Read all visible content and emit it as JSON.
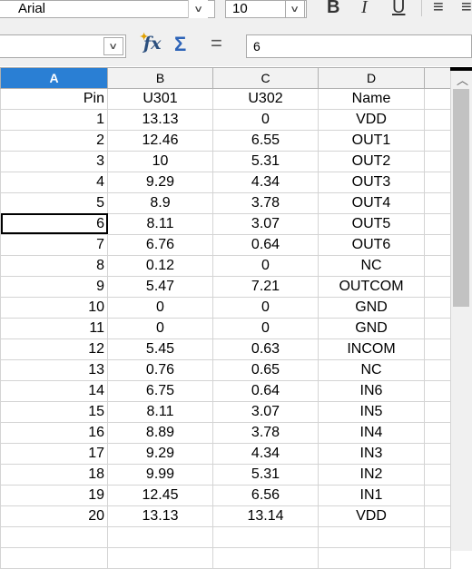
{
  "toolbar": {
    "font_name": "Arial",
    "font_size": "10",
    "bold_label": "B",
    "italic_label": "I",
    "underline_label": "U",
    "align_glyph": "≡"
  },
  "formula_bar": {
    "name_box": "",
    "formula_value": "6",
    "fx_glyph": "fx",
    "sum_glyph": "Σ",
    "equals_glyph": "="
  },
  "columns": [
    "A",
    "B",
    "C",
    "D"
  ],
  "header_row": {
    "a": "Pin",
    "b": "U301",
    "c": "U302",
    "d": "Name"
  },
  "rows": [
    {
      "a": "1",
      "b": "13.13",
      "c": "0",
      "d": "VDD"
    },
    {
      "a": "2",
      "b": "12.46",
      "c": "6.55",
      "d": "OUT1"
    },
    {
      "a": "3",
      "b": "10",
      "c": "5.31",
      "d": "OUT2"
    },
    {
      "a": "4",
      "b": "9.29",
      "c": "4.34",
      "d": "OUT3"
    },
    {
      "a": "5",
      "b": "8.9",
      "c": "3.78",
      "d": "OUT4"
    },
    {
      "a": "6",
      "b": "8.11",
      "c": "3.07",
      "d": "OUT5"
    },
    {
      "a": "7",
      "b": "6.76",
      "c": "0.64",
      "d": "OUT6"
    },
    {
      "a": "8",
      "b": "0.12",
      "c": "0",
      "d": "NC"
    },
    {
      "a": "9",
      "b": "5.47",
      "c": "7.21",
      "d": "OUTCOM"
    },
    {
      "a": "10",
      "b": "0",
      "c": "0",
      "d": "GND"
    },
    {
      "a": "11",
      "b": "0",
      "c": "0",
      "d": "GND"
    },
    {
      "a": "12",
      "b": "5.45",
      "c": "0.63",
      "d": "INCOM"
    },
    {
      "a": "13",
      "b": "0.76",
      "c": "0.65",
      "d": "NC"
    },
    {
      "a": "14",
      "b": "6.75",
      "c": "0.64",
      "d": "IN6"
    },
    {
      "a": "15",
      "b": "8.11",
      "c": "3.07",
      "d": "IN5"
    },
    {
      "a": "16",
      "b": "8.89",
      "c": "3.78",
      "d": "IN4"
    },
    {
      "a": "17",
      "b": "9.29",
      "c": "4.34",
      "d": "IN3"
    },
    {
      "a": "18",
      "b": "9.99",
      "c": "5.31",
      "d": "IN2"
    },
    {
      "a": "19",
      "b": "12.45",
      "c": "6.56",
      "d": "IN1"
    },
    {
      "a": "20",
      "b": "13.13",
      "c": "13.14",
      "d": "VDD"
    }
  ],
  "colors": {
    "selected_column_header": "#2a7fd4"
  }
}
